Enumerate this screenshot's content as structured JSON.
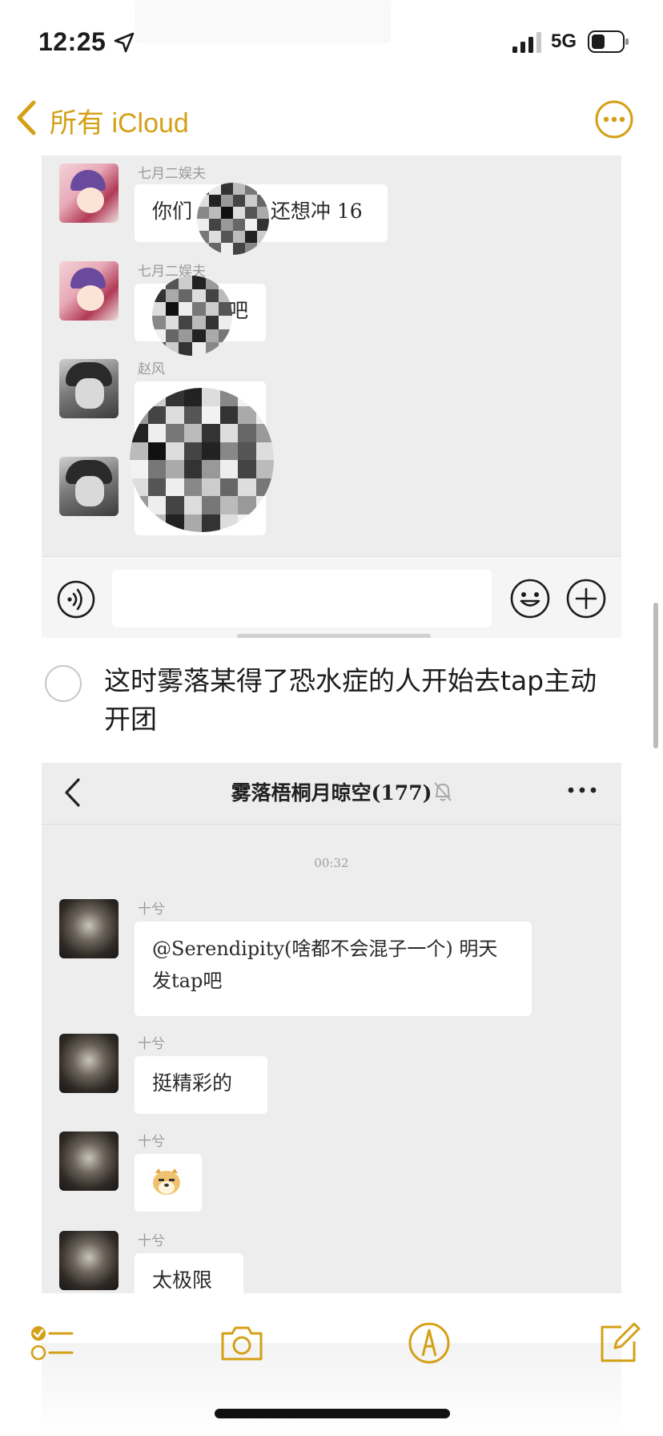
{
  "status": {
    "time": "12:25",
    "network": "5G"
  },
  "nav": {
    "back_label": "所有 iCloud"
  },
  "panel1": {
    "messages": [
      {
        "sender": "七月二娱夫",
        "text_left": "你们",
        "text_right": "还想冲 16"
      },
      {
        "sender": "七月二娱夫",
        "text_tail": "吧"
      },
      {
        "sender": "赵风"
      }
    ]
  },
  "checklist": {
    "text": "这时雾落某得了恐水症的人开始去tap主动开团",
    "checked": false
  },
  "panel2": {
    "title": "雾落梧桐月晾空(177)",
    "timestamp": "00:32",
    "messages": [
      {
        "sender": "十兮",
        "text": "@Serendipity(啥都不会混子一个) 明天发tap吧"
      },
      {
        "sender": "十兮",
        "text": "挺精彩的"
      },
      {
        "sender": "十兮",
        "emoji": "doge"
      },
      {
        "sender": "十兮",
        "text": "太极限"
      }
    ]
  },
  "toolbar": {
    "icons": [
      "checklist-icon",
      "camera-icon",
      "markup-icon",
      "compose-icon"
    ]
  },
  "colors": {
    "accent": "#d4a017",
    "panel_bg": "#ededed"
  }
}
